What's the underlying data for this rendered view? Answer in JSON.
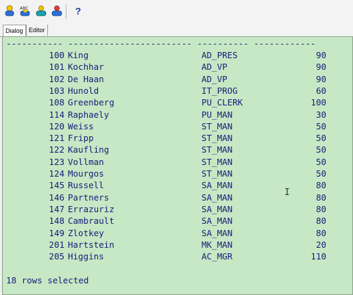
{
  "toolbar": {
    "icons": [
      "run-icon",
      "explain-icon",
      "execute-icon",
      "stop-icon",
      "help-icon"
    ],
    "help_label": "?"
  },
  "tabs": [
    {
      "label": "Dialog",
      "active": true
    },
    {
      "label": "Editor",
      "active": false
    }
  ],
  "output": {
    "separator": "----------- ------------------------ ---------- ------------",
    "rows": [
      {
        "id": "100",
        "name": "King",
        "job": "AD_PRES",
        "dept": "90"
      },
      {
        "id": "101",
        "name": "Kochhar",
        "job": "AD_VP",
        "dept": "90"
      },
      {
        "id": "102",
        "name": "De Haan",
        "job": "AD_VP",
        "dept": "90"
      },
      {
        "id": "103",
        "name": "Hunold",
        "job": "IT_PROG",
        "dept": "60"
      },
      {
        "id": "108",
        "name": "Greenberg",
        "job": "PU_CLERK",
        "dept": "100"
      },
      {
        "id": "114",
        "name": "Raphaely",
        "job": "PU_MAN",
        "dept": "30"
      },
      {
        "id": "120",
        "name": "Weiss",
        "job": "ST_MAN",
        "dept": "50"
      },
      {
        "id": "121",
        "name": "Fripp",
        "job": "ST_MAN",
        "dept": "50"
      },
      {
        "id": "122",
        "name": "Kaufling",
        "job": "ST_MAN",
        "dept": "50"
      },
      {
        "id": "123",
        "name": "Vollman",
        "job": "ST_MAN",
        "dept": "50"
      },
      {
        "id": "124",
        "name": "Mourgos",
        "job": "ST_MAN",
        "dept": "50"
      },
      {
        "id": "145",
        "name": "Russell",
        "job": "SA_MAN",
        "dept": "80"
      },
      {
        "id": "146",
        "name": "Partners",
        "job": "SA_MAN",
        "dept": "80"
      },
      {
        "id": "147",
        "name": "Errazuriz",
        "job": "SA_MAN",
        "dept": "80"
      },
      {
        "id": "148",
        "name": "Cambrault",
        "job": "SA_MAN",
        "dept": "80"
      },
      {
        "id": "149",
        "name": "Zlotkey",
        "job": "SA_MAN",
        "dept": "80"
      },
      {
        "id": "201",
        "name": "Hartstein",
        "job": "MK_MAN",
        "dept": "20"
      },
      {
        "id": "205",
        "name": "Higgins",
        "job": "AC_MGR",
        "dept": "110"
      }
    ],
    "footer": "18 rows selected"
  },
  "colors": {
    "output_bg": "#c6e8c4",
    "text": "#1a1a7a"
  }
}
